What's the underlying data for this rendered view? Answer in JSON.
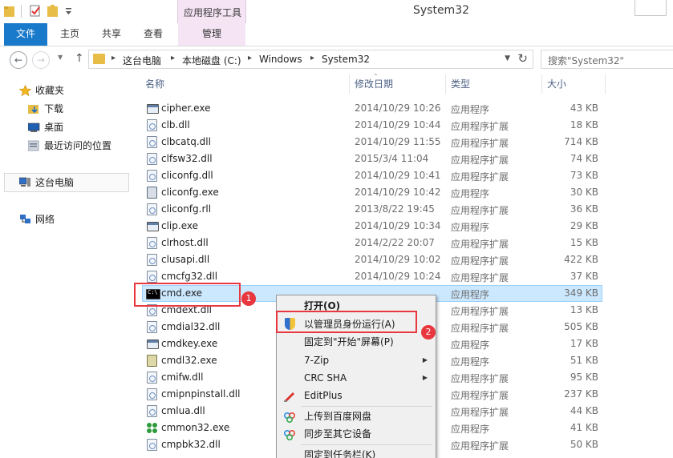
{
  "window": {
    "title": "System32"
  },
  "ribbon": {
    "context_group": "应用程序工具",
    "tabs": [
      {
        "label": "文件"
      },
      {
        "label": "主页"
      },
      {
        "label": "共享"
      },
      {
        "label": "查看"
      },
      {
        "label": "管理"
      }
    ]
  },
  "address": {
    "segments": [
      "这台电脑",
      "本地磁盘 (C:)",
      "Windows",
      "System32"
    ],
    "search_placeholder": "搜索\"System32\""
  },
  "nav_pane": {
    "items": [
      {
        "label": "收藏夹",
        "icon": "star-icon"
      },
      {
        "label": "下载",
        "icon": "downloads-folder-icon"
      },
      {
        "label": "桌面",
        "icon": "desktop-icon"
      },
      {
        "label": "最近访问的位置",
        "icon": "recent-places-icon"
      },
      {
        "label": "这台电脑",
        "icon": "computer-icon"
      },
      {
        "label": "网络",
        "icon": "network-icon"
      }
    ]
  },
  "file_list": {
    "columns": [
      "名称",
      "修改日期",
      "类型",
      "大小"
    ],
    "rows": [
      {
        "name": "cipher.exe",
        "date": "2014/10/29 10:26",
        "type": "应用程序",
        "size": "43 KB",
        "icon": "exe"
      },
      {
        "name": "clb.dll",
        "date": "2014/10/29 10:44",
        "type": "应用程序扩展",
        "size": "18 KB",
        "icon": "dll"
      },
      {
        "name": "clbcatq.dll",
        "date": "2014/10/29 11:55",
        "type": "应用程序扩展",
        "size": "714 KB",
        "icon": "dll"
      },
      {
        "name": "clfsw32.dll",
        "date": "2015/3/4 11:04",
        "type": "应用程序扩展",
        "size": "74 KB",
        "icon": "dll"
      },
      {
        "name": "cliconfg.dll",
        "date": "2014/10/29 10:41",
        "type": "应用程序扩展",
        "size": "73 KB",
        "icon": "dll"
      },
      {
        "name": "cliconfg.exe",
        "date": "2014/10/29 10:42",
        "type": "应用程序",
        "size": "30 KB",
        "icon": "cfg"
      },
      {
        "name": "cliconfg.rll",
        "date": "2013/8/22 19:45",
        "type": "应用程序扩展",
        "size": "36 KB",
        "icon": "dll"
      },
      {
        "name": "clip.exe",
        "date": "2014/10/29 10:34",
        "type": "应用程序",
        "size": "29 KB",
        "icon": "exe"
      },
      {
        "name": "clrhost.dll",
        "date": "2014/2/22 20:07",
        "type": "应用程序扩展",
        "size": "15 KB",
        "icon": "dll"
      },
      {
        "name": "clusapi.dll",
        "date": "2014/10/29 10:02",
        "type": "应用程序扩展",
        "size": "422 KB",
        "icon": "dll"
      },
      {
        "name": "cmcfg32.dll",
        "date": "2014/10/29 10:24",
        "type": "应用程序扩展",
        "size": "37 KB",
        "icon": "dll"
      },
      {
        "name": "cmd.exe",
        "date": "",
        "type": "应用程序",
        "size": "349 KB",
        "icon": "cmd",
        "selected": true
      },
      {
        "name": "cmdext.dll",
        "date": "",
        "type": "应用程序扩展",
        "size": "13 KB",
        "icon": "dll"
      },
      {
        "name": "cmdial32.dll",
        "date": "",
        "type": "应用程序扩展",
        "size": "505 KB",
        "icon": "dll"
      },
      {
        "name": "cmdkey.exe",
        "date": "",
        "type": "应用程序",
        "size": "17 KB",
        "icon": "exe"
      },
      {
        "name": "cmdl32.exe",
        "date": "",
        "type": "应用程序",
        "size": "51 KB",
        "icon": "dl"
      },
      {
        "name": "cmifw.dll",
        "date": "",
        "type": "应用程序扩展",
        "size": "95 KB",
        "icon": "dll"
      },
      {
        "name": "cmipnpinstall.dll",
        "date": "",
        "type": "应用程序扩展",
        "size": "237 KB",
        "icon": "dll"
      },
      {
        "name": "cmlua.dll",
        "date": "",
        "type": "应用程序扩展",
        "size": "44 KB",
        "icon": "dll"
      },
      {
        "name": "cmmon32.exe",
        "date": "",
        "type": "应用程序",
        "size": "41 KB",
        "icon": "mon"
      },
      {
        "name": "cmpbk32.dll",
        "date": "",
        "type": "应用程序扩展",
        "size": "50 KB",
        "icon": "dll"
      }
    ]
  },
  "context_menu": {
    "items": [
      {
        "label": "打开(O)",
        "bold": true
      },
      {
        "label": "以管理员身份运行(A)",
        "icon": "uac-shield-icon"
      },
      {
        "label": "固定到\"开始\"屏幕(P)"
      },
      {
        "label": "7-Zip",
        "submenu": true
      },
      {
        "label": "CRC SHA",
        "submenu": true
      },
      {
        "label": "EditPlus",
        "icon": "editplus-icon"
      },
      {
        "label": "上传到百度网盘",
        "icon": "baidu-cloud-icon"
      },
      {
        "label": "同步至其它设备",
        "icon": "sync-icon"
      },
      {
        "label": "固定到任务栏(K)"
      }
    ]
  },
  "annotations": [
    {
      "label": "1"
    },
    {
      "label": "2"
    }
  ],
  "colors": {
    "accent": "#1979ca",
    "context_tab": "#f5e4f4",
    "selection": "#cce8ff",
    "highlight_red": "#e8373e"
  }
}
